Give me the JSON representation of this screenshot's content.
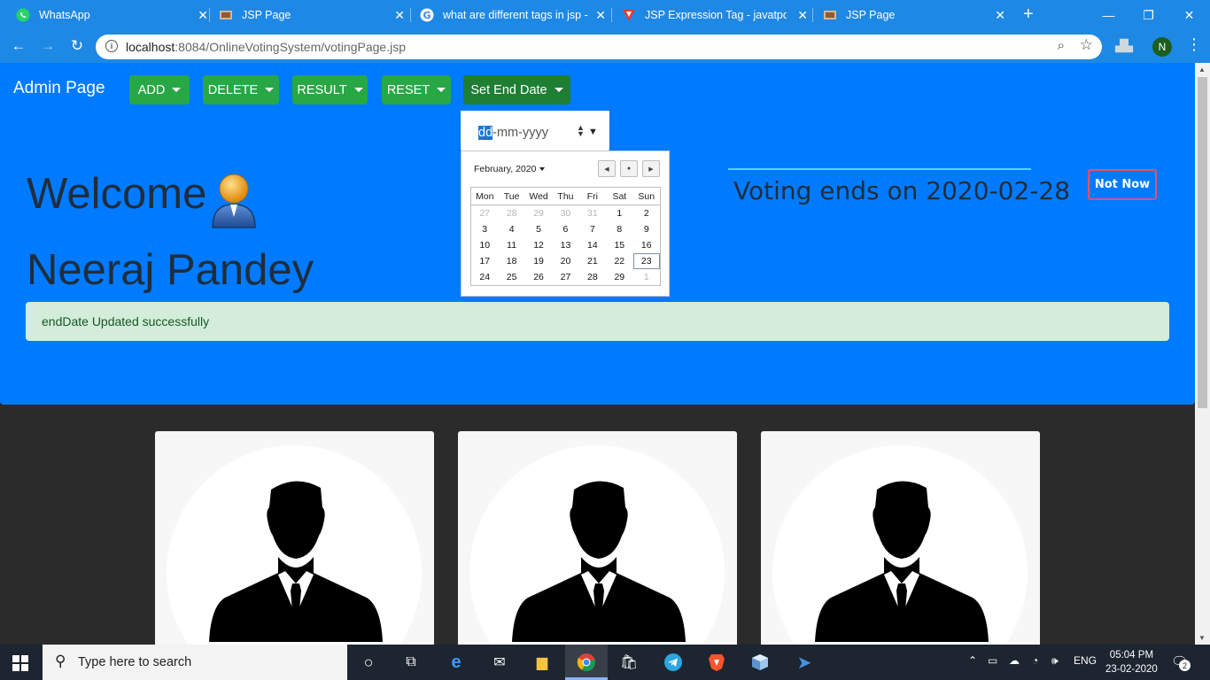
{
  "browser": {
    "tabs": [
      {
        "title": "WhatsApp",
        "icon": "whatsapp-icon"
      },
      {
        "title": "JSP Page",
        "icon": "page-icon"
      },
      {
        "title": "what are different tags in jsp -",
        "icon": "google-icon"
      },
      {
        "title": "JSP Expression Tag - javatpoint",
        "icon": "javatpoint-icon"
      },
      {
        "title": "JSP Page",
        "icon": "page-icon"
      }
    ],
    "url_host": "localhost",
    "url_rest": ":8084/OnlineVotingSystem/votingPage.jsp",
    "profile_initial": "N"
  },
  "navbar": {
    "brand": "Admin Page",
    "menus": [
      {
        "label": "ADD"
      },
      {
        "label": "DELETE"
      },
      {
        "label": "RESULT"
      },
      {
        "label": "RESET"
      },
      {
        "label": "Set End Date"
      }
    ]
  },
  "date_picker": {
    "input_day": "dd",
    "input_rest": "-mm-yyyy",
    "month_label": "February, 2020",
    "weekdays": [
      "Mon",
      "Tue",
      "Wed",
      "Thu",
      "Fri",
      "Sat",
      "Sun"
    ],
    "weeks": [
      [
        "27",
        "28",
        "29",
        "30",
        "31",
        "1",
        "2"
      ],
      [
        "3",
        "4",
        "5",
        "6",
        "7",
        "8",
        "9"
      ],
      [
        "10",
        "11",
        "12",
        "13",
        "14",
        "15",
        "16"
      ],
      [
        "17",
        "18",
        "19",
        "20",
        "21",
        "22",
        "23"
      ],
      [
        "24",
        "25",
        "26",
        "27",
        "28",
        "29",
        "1"
      ]
    ],
    "outside_month": [
      [
        0,
        0
      ],
      [
        0,
        1
      ],
      [
        0,
        2
      ],
      [
        0,
        3
      ],
      [
        0,
        4
      ],
      [
        4,
        6
      ]
    ],
    "today": [
      3,
      6
    ]
  },
  "hero": {
    "welcome": "Welcome",
    "username": "Neeraj Pandey",
    "voting_ends": "Voting ends on 2020-02-28",
    "not_now": "Not Now",
    "alert": "endDate Updated successfully"
  },
  "taskbar": {
    "search_placeholder": "Type here to search",
    "language": "ENG",
    "time": "05:04 PM",
    "date": "23-02-2020",
    "notification_count": "2"
  },
  "colors": {
    "hero_bg": "#007bff",
    "button_green": "#28a745",
    "browser_blue": "#1e88e5",
    "alert_bg": "#d4edda"
  }
}
